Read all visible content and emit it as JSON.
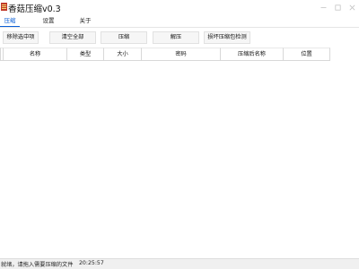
{
  "window": {
    "title": "香菇压缩v0.3",
    "minimize_icon": "minimize-icon",
    "maximize_icon": "maximize-icon",
    "close_icon": "close-icon"
  },
  "tabs": [
    {
      "label": "压缩",
      "active": true
    },
    {
      "label": "设置",
      "active": false
    },
    {
      "label": "关于",
      "active": false
    }
  ],
  "toolbar": {
    "buttons": [
      "移除选中项",
      "清空全部",
      "压缩",
      "解压",
      "损坏压缩包检测"
    ]
  },
  "table": {
    "columns": [
      "",
      "名称",
      "类型",
      "大小",
      "密码",
      "压缩后名称",
      "位置"
    ],
    "rows": []
  },
  "status": {
    "message": "就绪，请拖入需要压缩的文件",
    "time": "20:25:57"
  },
  "colors": {
    "accent": "#0b5fd6",
    "background": "#ffffff",
    "status_bar": "#f0f0f0"
  }
}
